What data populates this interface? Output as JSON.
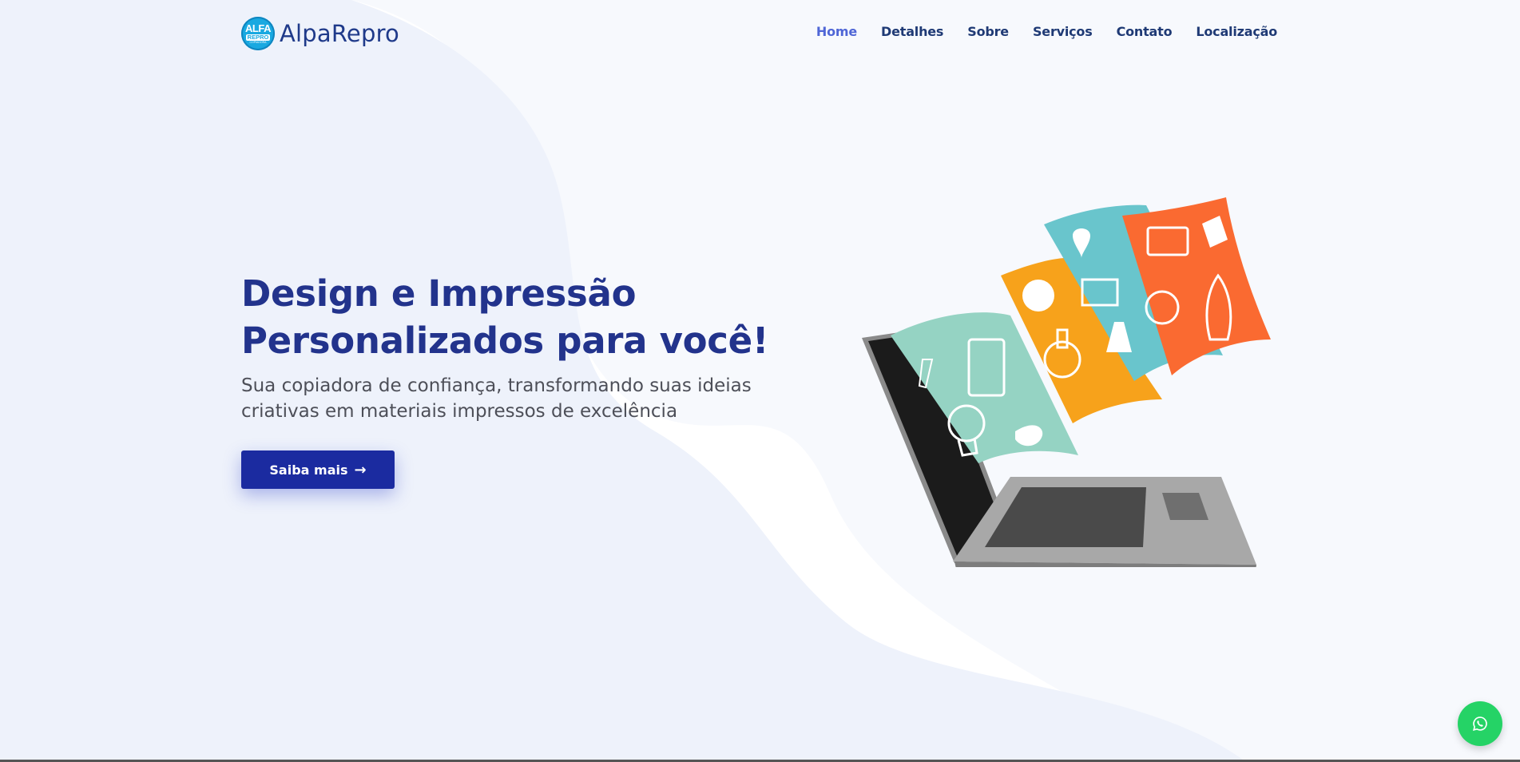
{
  "brand": {
    "logo_line1": "ALFA",
    "logo_line2": "REPRO",
    "logo_line3": "COPIADORA",
    "name": "AlpaRepro"
  },
  "nav": {
    "items": [
      {
        "label": "Home",
        "active": true
      },
      {
        "label": "Detalhes",
        "active": false
      },
      {
        "label": "Sobre",
        "active": false
      },
      {
        "label": "Serviços",
        "active": false
      },
      {
        "label": "Contato",
        "active": false
      },
      {
        "label": "Localização",
        "active": false
      }
    ]
  },
  "hero": {
    "title_line1": "Design e Impressão",
    "title_line2": "Personalizados para você!",
    "subtitle": "Sua copiadora de confiança, transformando suas ideias criativas em materiais impressos de excelência",
    "cta_label": "Saiba mais",
    "cta_icon": "arrow-right-icon"
  },
  "floating": {
    "whatsapp_icon": "whatsapp-icon"
  },
  "colors": {
    "primary": "#1b2ba0",
    "title": "#22338c",
    "nav_active": "#4f66d6",
    "nav": "#1f3a75",
    "whatsapp": "#25d366",
    "bg_wave": "#eef2fb"
  }
}
